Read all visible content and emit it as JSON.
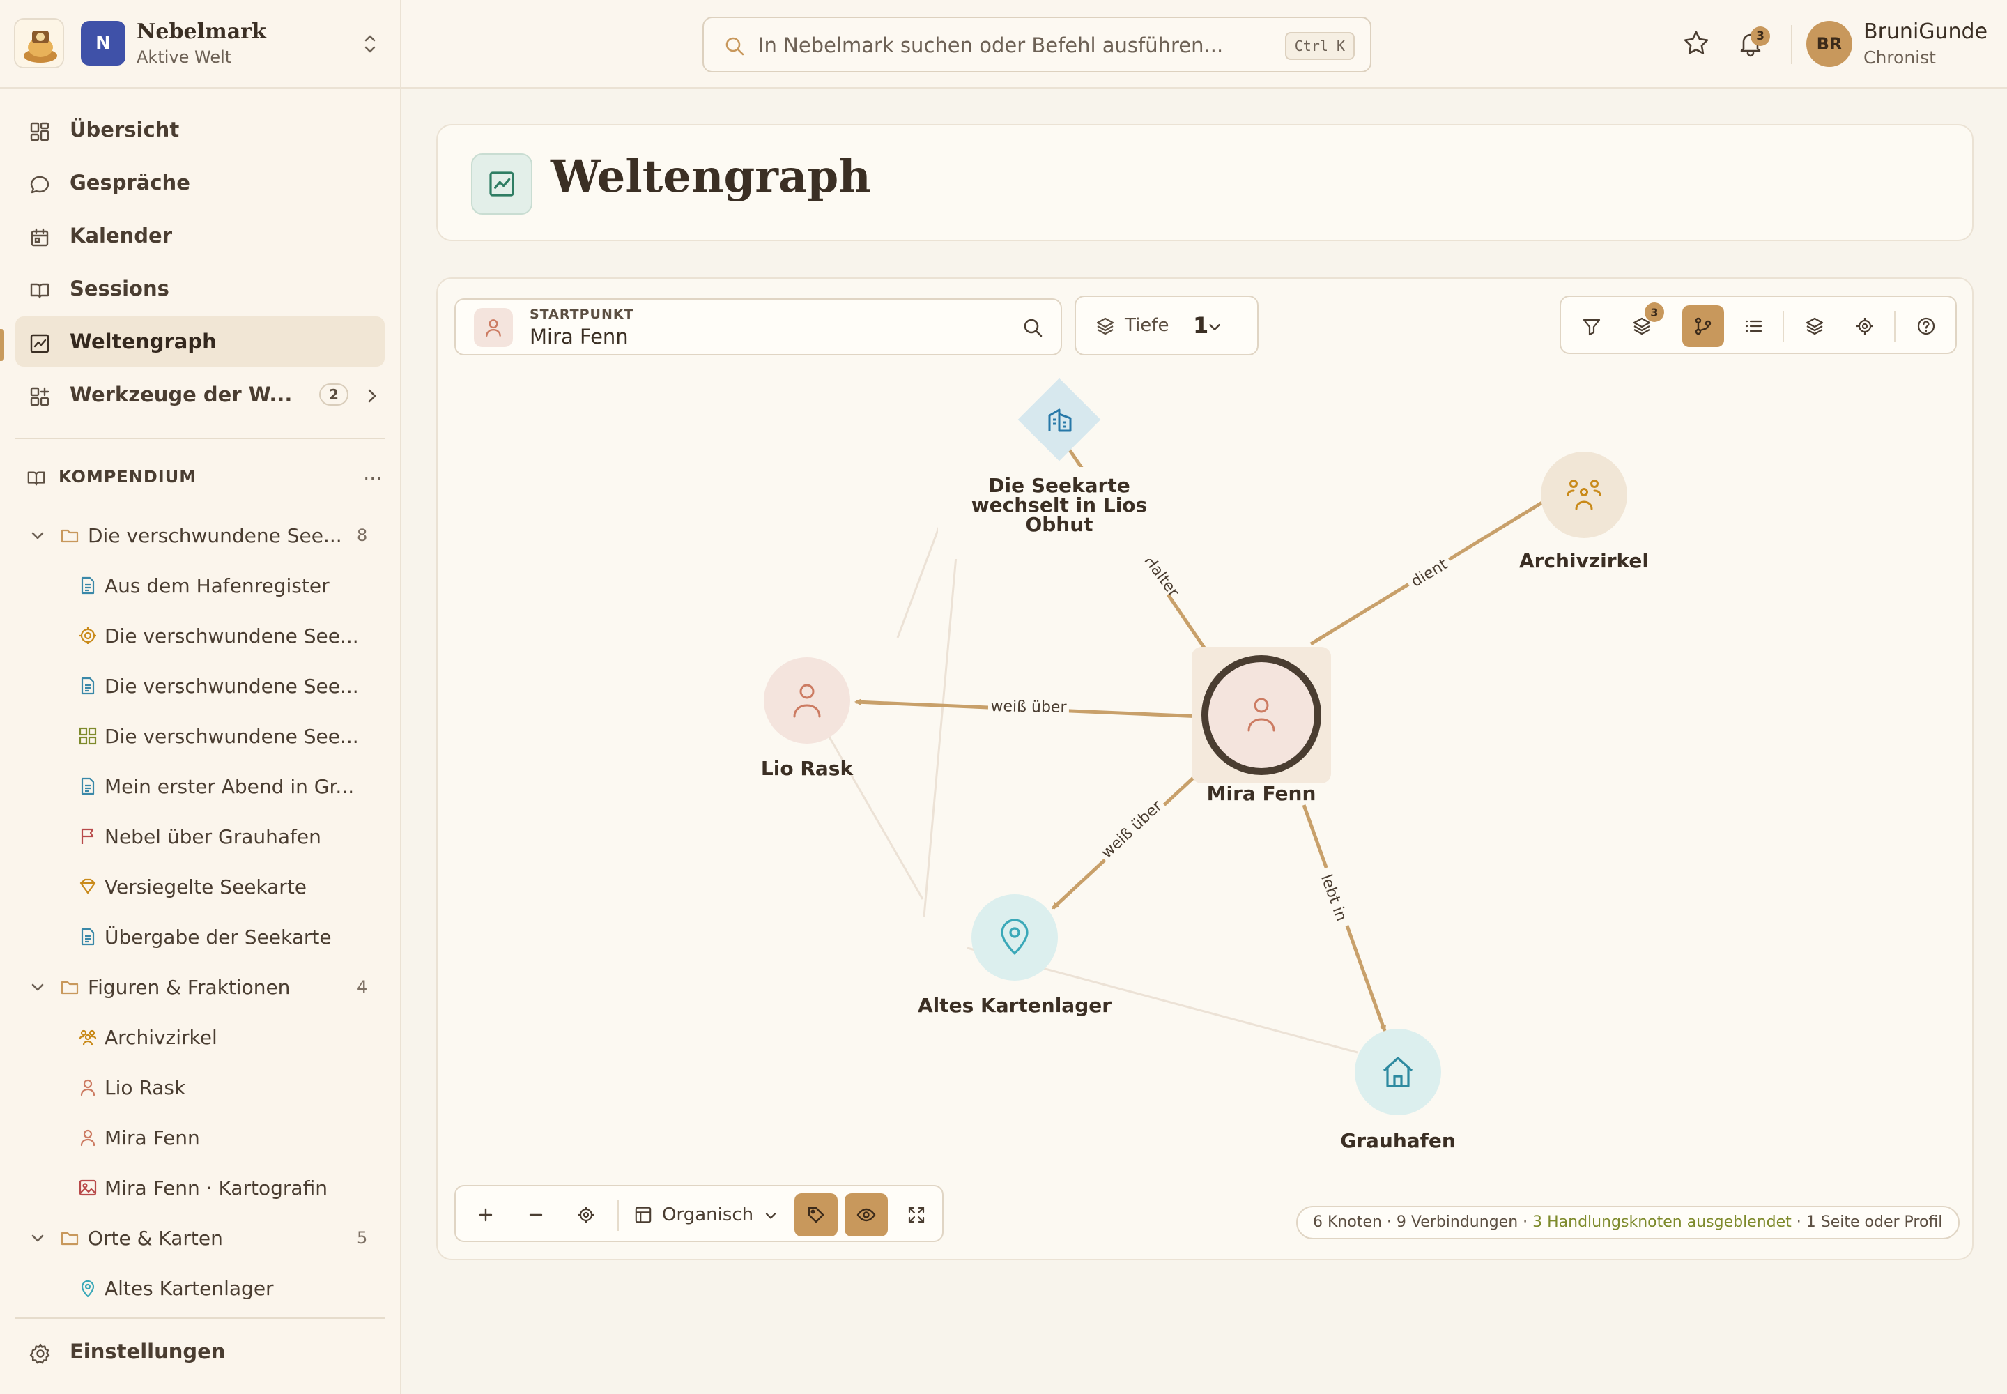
{
  "workspace": {
    "badge": "N",
    "name": "Nebelmark",
    "subtitle": "Aktive Welt"
  },
  "nav": [
    {
      "label": "Übersicht",
      "icon": "dashboard-icon"
    },
    {
      "label": "Gespräche",
      "icon": "chat-bubble-icon"
    },
    {
      "label": "Kalender",
      "icon": "calendar-icon"
    },
    {
      "label": "Sessions",
      "icon": "book-icon"
    },
    {
      "label": "Weltengraph",
      "icon": "chart-icon",
      "active": true
    },
    {
      "label": "Werkzeuge der W...",
      "icon": "widgets-icon",
      "badge": "2"
    }
  ],
  "compendium": {
    "title": "KOMPENDIUM",
    "more": "...",
    "folders": [
      {
        "label": "Die verschwundene See...",
        "count": "8",
        "items": [
          {
            "label": "Aus dem Hafenregister",
            "icon": "document-icon"
          },
          {
            "label": "Die verschwundene See...",
            "icon": "target-icon"
          },
          {
            "label": "Die verschwundene See...",
            "icon": "document-icon"
          },
          {
            "label": "Die verschwundene See...",
            "icon": "widgets-icon"
          },
          {
            "label": "Mein erster Abend in Gr...",
            "icon": "document-icon"
          },
          {
            "label": "Nebel über Grauhafen",
            "icon": "flag-icon"
          },
          {
            "label": "Versiegelte Seekarte",
            "icon": "tag-icon"
          },
          {
            "label": "Übergabe der Seekarte",
            "icon": "document-icon"
          }
        ]
      },
      {
        "label": "Figuren & Fraktionen",
        "count": "4",
        "items": [
          {
            "label": "Archivzirkel",
            "icon": "group-icon"
          },
          {
            "label": "Lio Rask",
            "icon": "person-icon"
          },
          {
            "label": "Mira Fenn",
            "icon": "person-icon"
          },
          {
            "label": "Mira Fenn · Kartografin",
            "icon": "image-icon"
          }
        ]
      },
      {
        "label": "Orte & Karten",
        "count": "5",
        "items": [
          {
            "label": "Altes Kartenlager",
            "icon": "pin-icon"
          }
        ]
      }
    ]
  },
  "settings": {
    "label": "Einstellungen"
  },
  "search": {
    "placeholder": "In Nebelmark suchen oder Befehl ausführen...",
    "shortcut": "Ctrl K"
  },
  "notifications": {
    "count": "3"
  },
  "user": {
    "initials": "BR",
    "name": "BruniGunde",
    "role": "Chronist"
  },
  "page": {
    "title": "Weltengraph"
  },
  "graph": {
    "start": {
      "caption": "STARTPUNKT",
      "value": "Mira Fenn"
    },
    "depth": {
      "label": "Tiefe",
      "value": "1"
    },
    "layers_badge": "3",
    "layout": "Organisch",
    "stats": {
      "main": "6 Knoten · 9 Verbindungen · ",
      "hidden": "3 Handlungsknoten ausgeblendet",
      "rest": " · 1 Seite oder Profil"
    },
    "nodes": [
      {
        "id": "seekarte",
        "label": [
          "Die Seekarte",
          "wechselt in Lios",
          "Obhut"
        ],
        "kind": "event"
      },
      {
        "id": "archiv",
        "label": [
          "Archivzirkel"
        ],
        "kind": "group"
      },
      {
        "id": "lio",
        "label": [
          "Lio Rask"
        ],
        "kind": "person"
      },
      {
        "id": "mira",
        "label": [
          "Mira Fenn"
        ],
        "kind": "person-center"
      },
      {
        "id": "lager",
        "label": [
          "Altes Kartenlager"
        ],
        "kind": "place"
      },
      {
        "id": "grau",
        "label": [
          "Grauhafen"
        ],
        "kind": "town"
      }
    ],
    "edges": [
      {
        "from": "mira",
        "to": "seekarte",
        "label": "...iger Halter"
      },
      {
        "from": "mira",
        "to": "archiv",
        "label": "dient"
      },
      {
        "from": "mira",
        "to": "lio",
        "label": "weiß über"
      },
      {
        "from": "mira",
        "to": "lager",
        "label": "weiß über"
      },
      {
        "from": "mira",
        "to": "grau",
        "label": "lebt in"
      }
    ]
  }
}
